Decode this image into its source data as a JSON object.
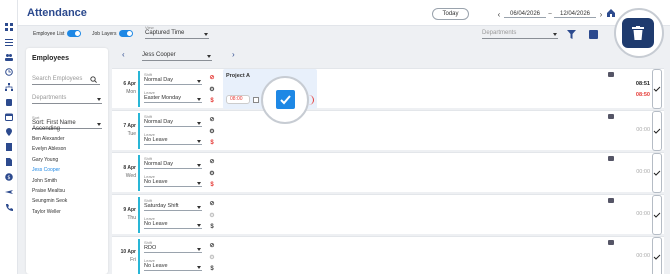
{
  "header": {
    "title": "Attendance",
    "today_label": "Today",
    "date_from": "06/04/2026",
    "date_sep": "–",
    "date_to": "12/04/2026"
  },
  "filters": {
    "employee_list_label": "Employee List",
    "job_layers_label": "Job Layers",
    "view_label": "View",
    "view_value": "Captured Time",
    "departments_placeholder": "Departments"
  },
  "employees_panel": {
    "title": "Employees",
    "search_placeholder": "Search Employees",
    "departments_placeholder": "Departments",
    "sort_label": "Sort",
    "sort_value": "Sort: First Name Ascending",
    "list": [
      {
        "name": "Ben Alexander",
        "active": false
      },
      {
        "name": "Evelyn Ableson",
        "active": false
      },
      {
        "name": "Gary Young",
        "active": false
      },
      {
        "name": "Jess Cooper",
        "active": true
      },
      {
        "name": "John Smith",
        "active": false
      },
      {
        "name": "Praise Mealtsu",
        "active": false
      },
      {
        "name": "Seungmin Seok",
        "active": false
      },
      {
        "name": "Taylor Weller",
        "active": false
      }
    ]
  },
  "grid": {
    "selected_employee": "Jess Cooper",
    "shift_label": "Shift",
    "leave_label": "Leave",
    "days": [
      {
        "date": "6 Apr",
        "day": "Mon",
        "shift": "Normal Day",
        "leave": "Easter Monday",
        "time": "08:51",
        "time2": "08:50"
      },
      {
        "date": "7 Apr",
        "day": "Tue",
        "shift": "Normal Day",
        "leave": "No Leave",
        "time": "00:00"
      },
      {
        "date": "8 Apr",
        "day": "Wed",
        "shift": "Normal Day",
        "leave": "No Leave",
        "time": "00:00"
      },
      {
        "date": "9 Apr",
        "day": "Thu",
        "shift": "Saturday Shift",
        "leave": "No Leave",
        "time": "00:00"
      },
      {
        "date": "10 Apr",
        "day": "Fri",
        "shift": "RDO",
        "leave": "No Leave",
        "time": "00:00"
      }
    ],
    "project": {
      "title": "Project A",
      "time": "08:00"
    }
  },
  "colors": {
    "brand": "#2c4a8e",
    "accent": "#1e88e5",
    "danger": "#e53935",
    "shift_bar": "#29b6d6"
  }
}
